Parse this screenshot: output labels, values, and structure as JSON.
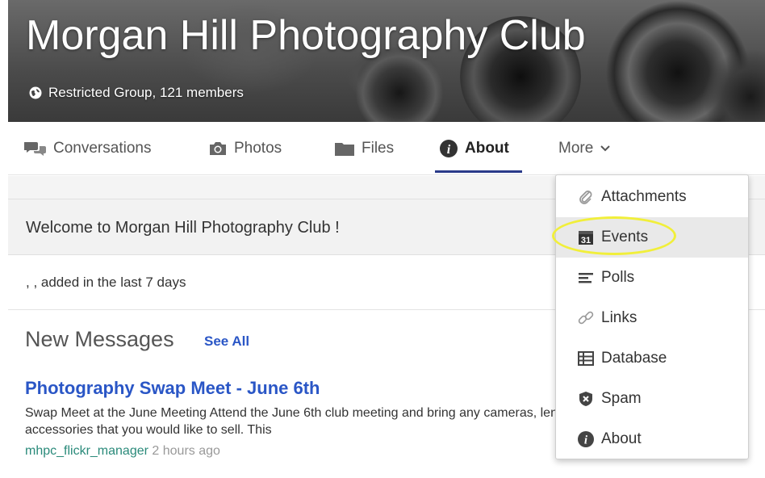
{
  "group": {
    "title": "Morgan Hill Photography Club",
    "subtitle": "Restricted Group, 121 members",
    "subtitle_icon": "globe-icon"
  },
  "tabs": [
    {
      "label": "Conversations",
      "icon": "conversations-icon"
    },
    {
      "label": "Photos",
      "icon": "camera-icon"
    },
    {
      "label": "Files",
      "icon": "folder-icon"
    },
    {
      "label": "About",
      "icon": "info-icon",
      "active": true
    },
    {
      "label": "More",
      "icon": "chevron-down-icon"
    }
  ],
  "welcome": {
    "text": "Welcome to Morgan Hill Photography Club !"
  },
  "added_text": ", , added in the last 7 days",
  "messages": {
    "heading": "New Messages",
    "see_all": "See All",
    "items": [
      {
        "title": "Photography Swap Meet - June 6th",
        "body_line1": "Swap Meet at the June Meeting Attend the June 6th club meeting and bring any cameras, lenses, and other equ",
        "body_line2": "accessories that you would like to sell. This",
        "author": "mhpc_flickr_manager",
        "time": "2 hours ago"
      }
    ]
  },
  "more_menu": {
    "items": [
      {
        "label": "Attachments",
        "icon": "paperclip-icon"
      },
      {
        "label": "Events",
        "icon": "calendar-icon",
        "highlighted": true
      },
      {
        "label": "Polls",
        "icon": "poll-icon"
      },
      {
        "label": "Links",
        "icon": "link-icon"
      },
      {
        "label": "Database",
        "icon": "database-icon"
      },
      {
        "label": "Spam",
        "icon": "spam-shield-icon"
      },
      {
        "label": "About",
        "icon": "info-icon"
      }
    ]
  },
  "colors": {
    "link_blue": "#2a56c6",
    "active_underline": "#2a3a8a",
    "highlight_ring": "#f1ef3a",
    "author_teal": "#2a8a7a"
  }
}
